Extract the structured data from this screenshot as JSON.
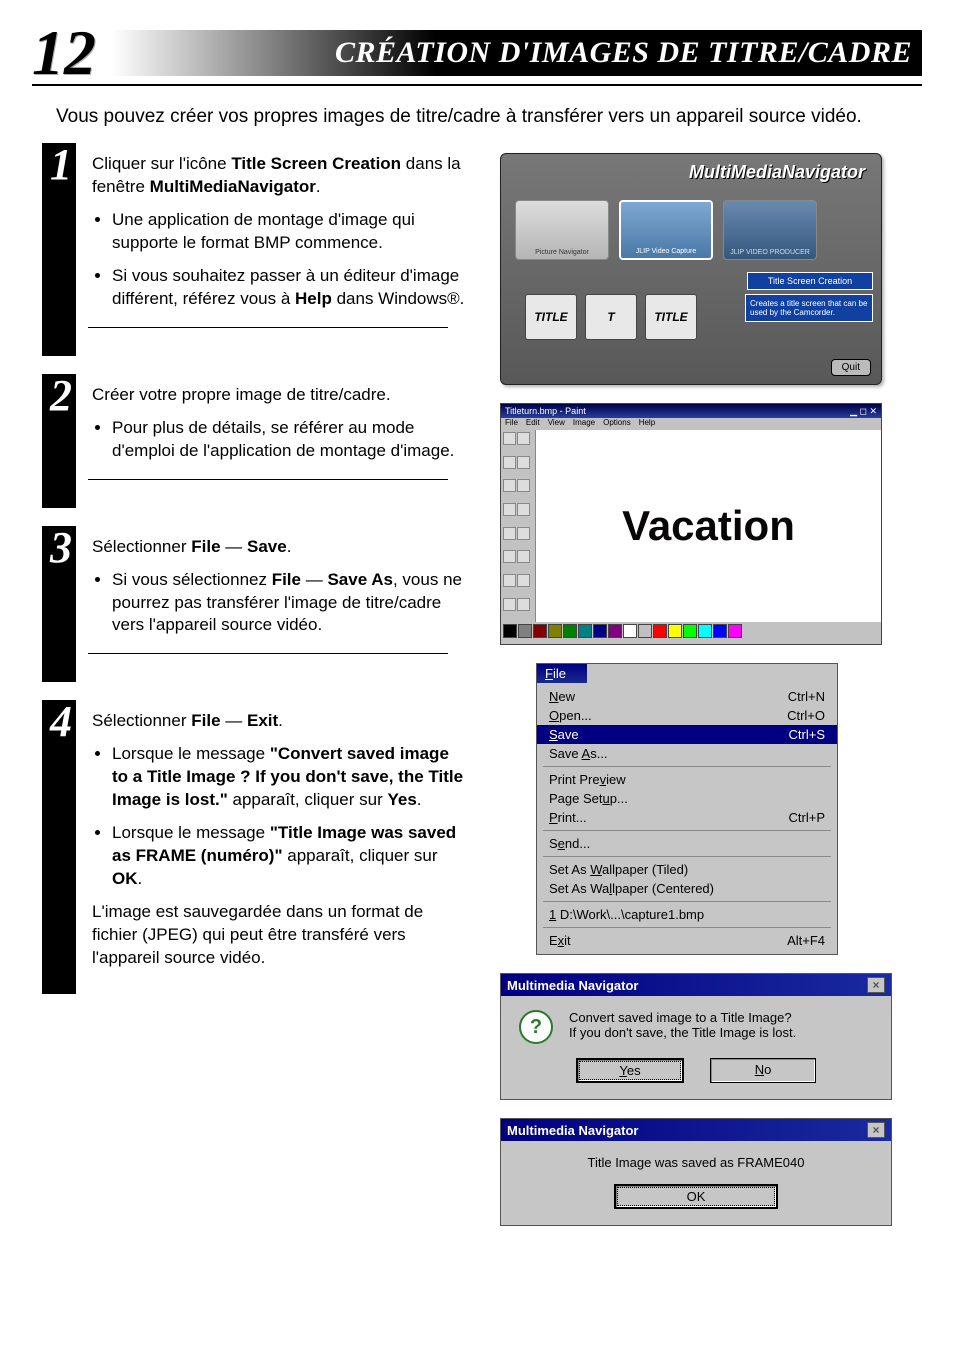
{
  "pageNumber": "12",
  "pageTitle": "CRÉATION D'IMAGES DE TITRE/CADRE",
  "intro": "Vous pouvez créer vos propres images de titre/cadre à transférer vers un appareil source vidéo.",
  "steps": [
    {
      "num": "1",
      "lead": "Cliquer sur l'icône ",
      "leadBold": "Title Screen Creation",
      "leadTail": " dans la fenêtre ",
      "leadBold2": "MultiMediaNavigator",
      "leadEnd": ".",
      "bullets": [
        {
          "text": "Une application de montage d'image qui supporte le format BMP commence."
        },
        {
          "textPre": "Si vous souhaitez passer à un éditeur d'image différent, référez vous à ",
          "bold": "Help",
          "textPost": " dans Windows®."
        }
      ]
    },
    {
      "num": "2",
      "plain": "Créer votre propre image de titre/cadre.",
      "bullets": [
        {
          "text": "Pour plus de détails, se référer au mode d'emploi de l'application de montage d'image."
        }
      ]
    },
    {
      "num": "3",
      "lead": "Sélectionner ",
      "leadBold": "File",
      "leadMid": " — ",
      "leadBold2": "Save",
      "leadEnd": ".",
      "bullets": [
        {
          "textPre": "Si vous sélectionnez ",
          "bold": "File",
          "mid": " — ",
          "bold2": "Save As",
          "textPost": ", vous ne pourrez pas transférer l'image de titre/cadre vers l'appareil source vidéo."
        }
      ]
    },
    {
      "num": "4",
      "lead": "Sélectionner ",
      "leadBold": "File",
      "leadMid": " — ",
      "leadBold2": "Exit",
      "leadEnd": ".",
      "bullets": [
        {
          "textPre": "Lorsque le message ",
          "bold": "\"Convert saved image to a Title Image ? If you don't save, the Title Image is lost.\"",
          "textPost": " apparaît, cliquer sur ",
          "bold3": "Yes",
          "tail": "."
        },
        {
          "textPre": "Lorsque le message ",
          "bold": "\"Title Image was saved as FRAME (numéro)\"",
          "textPost": " apparaît, cliquer sur ",
          "bold3": "OK",
          "tail": "."
        }
      ],
      "after": "L'image est sauvegardée dans un format de fichier (JPEG) qui peut être transféré vers l'appareil source vidéo."
    }
  ],
  "mmn": {
    "logo": "MultiMediaNavigator",
    "thumbs": [
      "Picture Navigator",
      "JLIP Video Capture",
      "JLIP VIDEO PRODUCER"
    ],
    "tagTitle": "Title Screen Creation",
    "desc": "Creates a title screen that can be used by the Camcorder.",
    "quit": "Quit",
    "tiles": [
      "TITLE",
      "T",
      "TITLE"
    ]
  },
  "paint": {
    "titlebar": "Titleturn.bmp - Paint",
    "menu": [
      "File",
      "Edit",
      "View",
      "Image",
      "Options",
      "Help"
    ],
    "canvasText": "Vacation",
    "palette": [
      "#000",
      "#808080",
      "#800000",
      "#808000",
      "#008000",
      "#008080",
      "#000080",
      "#800080",
      "#ffffff",
      "#c0c0c0",
      "#ff0000",
      "#ffff00",
      "#00ff00",
      "#00ffff",
      "#0000ff",
      "#ff00ff"
    ]
  },
  "fileMenu": {
    "title": "File",
    "items": [
      {
        "label": "New",
        "sc": "Ctrl+N",
        "u": "N"
      },
      {
        "label": "Open...",
        "sc": "Ctrl+O",
        "u": "O"
      },
      {
        "label": "Save",
        "sc": "Ctrl+S",
        "u": "S",
        "sel": true
      },
      {
        "label": "Save As...",
        "u": "A"
      },
      {
        "sep": true
      },
      {
        "label": "Print Preview",
        "u": "v"
      },
      {
        "label": "Page Setup...",
        "u": "u"
      },
      {
        "label": "Print...",
        "sc": "Ctrl+P",
        "u": "P"
      },
      {
        "sep": true
      },
      {
        "label": "Send...",
        "u": "e"
      },
      {
        "sep": true
      },
      {
        "label": "Set As Wallpaper (Tiled)",
        "u": "W"
      },
      {
        "label": "Set As Wallpaper (Centered)",
        "u": "l"
      },
      {
        "sep": true
      },
      {
        "label": "1 D:\\Work\\...\\capture1.bmp",
        "u": "1"
      },
      {
        "sep": true
      },
      {
        "label": "Exit",
        "sc": "Alt+F4",
        "u": "x"
      }
    ]
  },
  "dlg1": {
    "title": "Multimedia Navigator",
    "msg1": "Convert saved image to a Title Image?",
    "msg2": "If you don't save, the Title Image is lost.",
    "yes": "Yes",
    "no": "No"
  },
  "dlg2": {
    "title": "Multimedia Navigator",
    "msg": "Title Image was saved as FRAME040",
    "ok": "OK"
  }
}
